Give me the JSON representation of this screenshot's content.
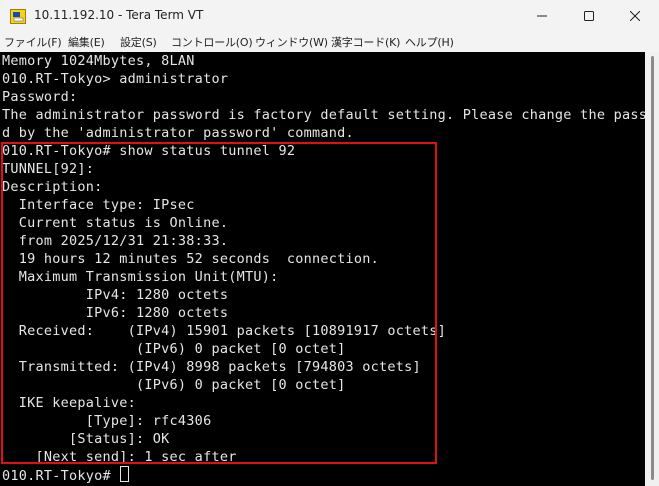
{
  "window": {
    "title": "10.11.192.10 - Tera Term VT",
    "app_icon": "teraterm-icon",
    "controls": [
      "minimize-icon",
      "maximize-icon",
      "close-icon"
    ]
  },
  "menu": {
    "items": [
      "ファイル(F)",
      "編集(E)",
      "設定(S)",
      "コントロール(O)",
      "ウィンドウ(W)",
      "漢字コード(K)",
      "ヘルプ(H)"
    ]
  },
  "terminal": {
    "lines": [
      "Memory 1024Mbytes, 8LAN",
      "010.RT-Tokyo> administrator",
      "Password:",
      "The administrator password is factory default setting. Please change the passwo",
      "d by the 'administrator password' command.",
      "010.RT-Tokyo# show status tunnel 92",
      "TUNNEL[92]:",
      "Description:",
      "  Interface type: IPsec",
      "  Current status is Online.",
      "  from 2025/12/31 21:38:33.",
      "  19 hours 12 minutes 52 seconds  connection.",
      "  Maximum Transmission Unit(MTU):",
      "          IPv4: 1280 octets",
      "          IPv6: 1280 octets",
      "  Received:    (IPv4) 15901 packets [10891917 octets]",
      "                (IPv6) 0 packet [0 octet]",
      "  Transmitted: (IPv4) 8998 packets [794803 octets]",
      "                (IPv6) 0 packet [0 octet]",
      "  IKE keepalive:",
      "          [Type]: rfc4306",
      "        [Status]: OK",
      "    [Next send]: 1 sec after"
    ],
    "prompt": "010.RT-Tokyo# "
  },
  "colors": {
    "terminal_bg": "#000000",
    "terminal_fg": "#e6e6e6",
    "highlight": "#e0101a",
    "titlebar_bg": "#f3f3f3"
  }
}
